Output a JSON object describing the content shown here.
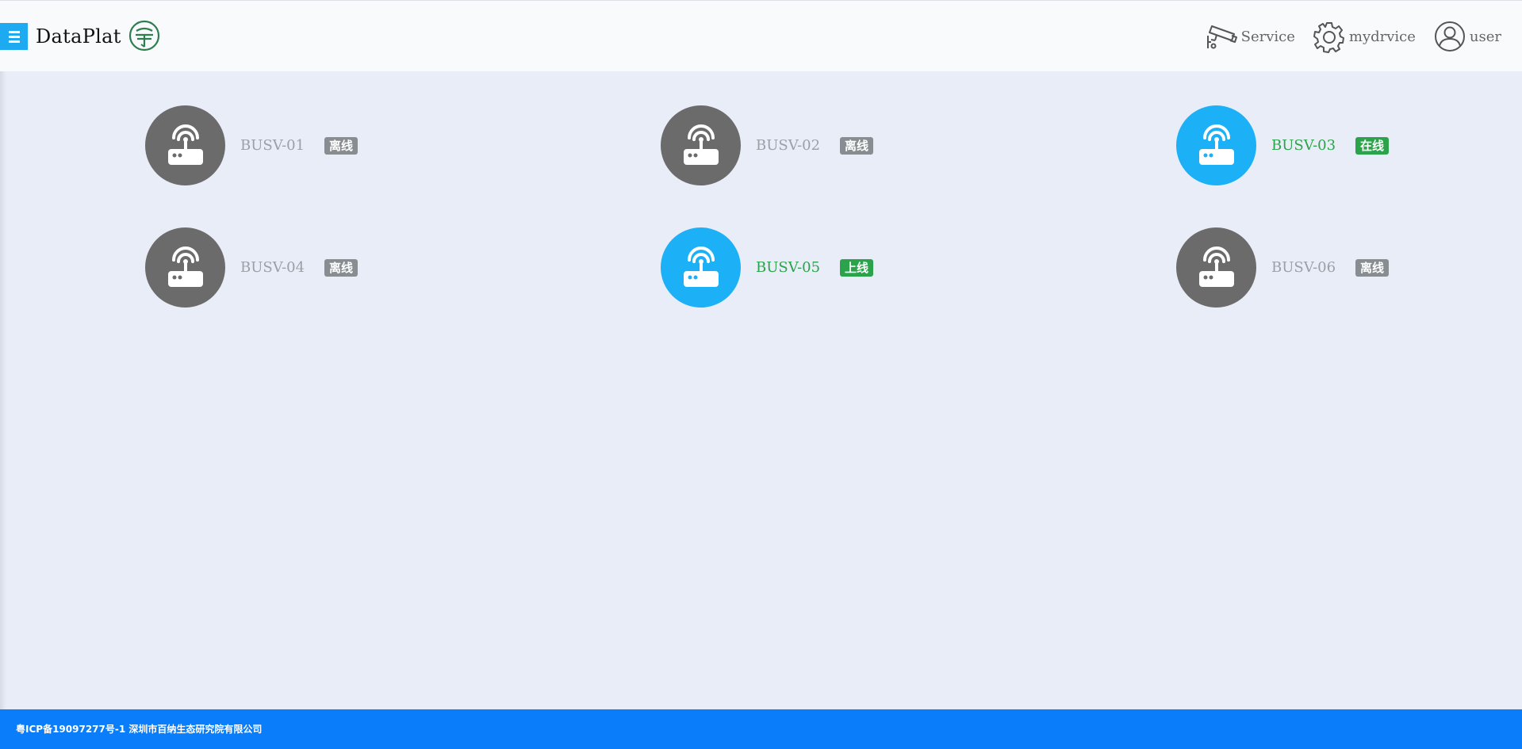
{
  "header": {
    "brand": "DataPlat",
    "nav": [
      {
        "label": "Service",
        "icon": "camera-icon"
      },
      {
        "label": "mydrvice",
        "icon": "gear-icon"
      },
      {
        "label": "user",
        "icon": "user-avatar-icon"
      }
    ]
  },
  "devices": [
    {
      "name": "BUSV-01",
      "status": "离线",
      "online": false
    },
    {
      "name": "BUSV-02",
      "status": "离线",
      "online": false
    },
    {
      "name": "BUSV-03",
      "status": "在线",
      "online": true
    },
    {
      "name": "BUSV-04",
      "status": "离线",
      "online": false
    },
    {
      "name": "BUSV-05",
      "status": "上线",
      "online": true
    },
    {
      "name": "BUSV-06",
      "status": "离线",
      "online": false
    }
  ],
  "footer": {
    "icp": "粤ICP备19097277号-1",
    "company": "深圳市百纳生态研究院有限公司"
  },
  "colors": {
    "accent": "#1eaaf1",
    "online_circle": "#1cb0f6",
    "offline_circle": "#6b6b6b",
    "online_text": "#2aa34a",
    "offline_badge": "#888d91",
    "footer": "#0a7dfa",
    "page_bg": "#e9edf7"
  }
}
